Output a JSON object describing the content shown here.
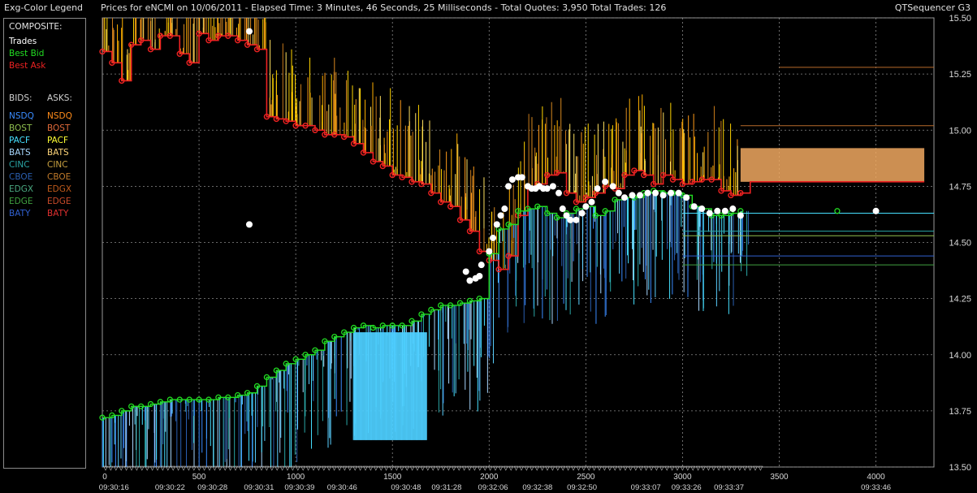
{
  "header": {
    "legend_title": "Exg-Color Legend",
    "chart_title": "Prices for  eNCMI  on  10/06/2011  -  Elapsed Time: 3 Minutes, 46 Seconds, 25 Milliseconds  -  Total Quotes: 3,950  Total Trades: 126",
    "app_name": "QTSequencer G3"
  },
  "legend": {
    "composite_label": "COMPOSITE:",
    "composite": [
      {
        "label": "Trades",
        "color": "#ffffff"
      },
      {
        "label": "Best Bid",
        "color": "#22dd22"
      },
      {
        "label": "Best Ask",
        "color": "#ee2222"
      }
    ],
    "bids_label": "BIDS:",
    "asks_label": "ASKS:",
    "exchanges": [
      {
        "bid": "NSDQ",
        "ask": "NSDQ",
        "bid_color": "#3a8cff",
        "ask_color": "#ff8c1a"
      },
      {
        "bid": "BOST",
        "ask": "BOST",
        "bid_color": "#8fbf4f",
        "ask_color": "#e06a3a"
      },
      {
        "bid": "PACF",
        "ask": "PACF",
        "bid_color": "#46e0ff",
        "ask_color": "#ffff33"
      },
      {
        "bid": "BATS",
        "ask": "BATS",
        "bid_color": "#a8d8ff",
        "ask_color": "#ffd67a"
      },
      {
        "bid": "CINC",
        "ask": "CINC",
        "bid_color": "#2aa6a6",
        "ask_color": "#c8a040"
      },
      {
        "bid": "CBOE",
        "ask": "CBOE",
        "bid_color": "#2a5fb0",
        "ask_color": "#c07a2a"
      },
      {
        "bid": "EDGX",
        "ask": "EDGX",
        "bid_color": "#4aa880",
        "ask_color": "#c05a1a"
      },
      {
        "bid": "EDGE",
        "ask": "EDGE",
        "bid_color": "#40a040",
        "ask_color": "#c84a2a"
      },
      {
        "bid": "BATY",
        "ask": "BATY",
        "bid_color": "#3060d0",
        "ask_color": "#e03030"
      }
    ]
  },
  "chart_data": {
    "type": "line",
    "ylim": [
      13.5,
      15.5
    ],
    "xlim": [
      0,
      4300
    ],
    "y_ticks": [
      "15.50",
      "15.25",
      "15.00",
      "14.75",
      "14.50",
      "14.25",
      "14.00",
      "13.75",
      "13.50"
    ],
    "x_ticks": [
      0,
      500,
      1000,
      1500,
      2000,
      2500,
      3000,
      3500,
      4000
    ],
    "time_labels": [
      {
        "x": 60,
        "label": "09:30:16"
      },
      {
        "x": 350,
        "label": "09:30:22"
      },
      {
        "x": 570,
        "label": "09:30:28"
      },
      {
        "x": 810,
        "label": "09:30:31"
      },
      {
        "x": 1020,
        "label": "09:30:39"
      },
      {
        "x": 1240,
        "label": "09:30:46"
      },
      {
        "x": 1570,
        "label": "09:30:48"
      },
      {
        "x": 1780,
        "label": "09:31:28"
      },
      {
        "x": 2020,
        "label": "09:32:06"
      },
      {
        "x": 2250,
        "label": "09:32:38"
      },
      {
        "x": 2480,
        "label": "09:32:50"
      },
      {
        "x": 2810,
        "label": "09:33:07"
      },
      {
        "x": 3020,
        "label": "09:33:26"
      },
      {
        "x": 3240,
        "label": "09:33:37"
      },
      {
        "x": 4000,
        "label": "09:33:46"
      }
    ],
    "grid": true,
    "series": [
      {
        "name": "Best Ask",
        "color": "#ee2222",
        "x": [
          0,
          50,
          100,
          150,
          200,
          250,
          300,
          350,
          400,
          450,
          500,
          550,
          600,
          650,
          700,
          750,
          800,
          850,
          900,
          950,
          1000,
          1050,
          1100,
          1150,
          1200,
          1250,
          1300,
          1350,
          1400,
          1450,
          1500,
          1550,
          1600,
          1650,
          1700,
          1750,
          1800,
          1850,
          1900,
          1950,
          2000,
          2050,
          2100,
          2150,
          2200,
          2250,
          2300,
          2350,
          2400,
          2450,
          2500,
          2550,
          2600,
          2650,
          2700,
          2750,
          2800,
          2850,
          2900,
          2950,
          3000,
          3050,
          3100,
          3150,
          3200,
          3250,
          3300,
          3350,
          3400,
          3450,
          3500,
          3550,
          3600,
          3650,
          3700,
          3750,
          3800,
          3850,
          3900,
          3950,
          4000,
          4050,
          4100,
          4150,
          4200,
          4250
        ],
        "values": [
          15.35,
          15.3,
          15.22,
          15.38,
          15.4,
          15.36,
          15.42,
          15.42,
          15.34,
          15.3,
          15.43,
          15.4,
          15.42,
          15.42,
          15.4,
          15.38,
          15.36,
          15.06,
          15.05,
          15.04,
          15.02,
          15.02,
          15.0,
          14.98,
          14.98,
          14.97,
          14.94,
          14.9,
          14.86,
          14.84,
          14.8,
          14.79,
          14.77,
          14.76,
          14.72,
          14.68,
          14.66,
          14.6,
          14.55,
          14.46,
          14.42,
          14.38,
          14.44,
          14.62,
          14.75,
          14.76,
          14.8,
          14.81,
          14.72,
          14.68,
          14.7,
          14.72,
          14.75,
          14.74,
          14.8,
          14.82,
          14.8,
          14.76,
          14.8,
          14.78,
          14.76,
          14.77,
          14.78,
          14.78,
          14.73,
          14.71,
          14.72,
          14.77,
          14.77,
          14.77,
          14.77,
          14.77,
          14.77,
          14.77,
          14.77,
          14.77,
          14.77,
          14.77,
          14.77,
          14.77,
          14.77,
          14.77,
          14.77,
          14.77,
          14.77,
          14.77
        ]
      },
      {
        "name": "Best Bid",
        "color": "#22dd22",
        "x": [
          0,
          50,
          100,
          150,
          200,
          250,
          300,
          350,
          400,
          450,
          500,
          550,
          600,
          650,
          700,
          750,
          800,
          850,
          900,
          950,
          1000,
          1050,
          1100,
          1150,
          1200,
          1250,
          1300,
          1350,
          1400,
          1450,
          1500,
          1550,
          1600,
          1650,
          1700,
          1750,
          1800,
          1850,
          1900,
          1950,
          2000,
          2050,
          2100,
          2150,
          2200,
          2250,
          2300,
          2350,
          2400,
          2450,
          2500,
          2550,
          2600,
          2650,
          2700,
          2750,
          2800,
          2850,
          2900,
          2950,
          3000,
          3050,
          3100,
          3150,
          3200,
          3250,
          3300
        ],
        "values": [
          13.72,
          13.73,
          13.75,
          13.77,
          13.77,
          13.78,
          13.79,
          13.8,
          13.8,
          13.8,
          13.8,
          13.8,
          13.81,
          13.81,
          13.82,
          13.83,
          13.86,
          13.9,
          13.93,
          13.96,
          13.98,
          14.0,
          14.02,
          14.06,
          14.08,
          14.1,
          14.12,
          14.13,
          14.12,
          14.13,
          14.13,
          14.13,
          14.15,
          14.18,
          14.2,
          14.22,
          14.22,
          14.23,
          14.24,
          14.25,
          14.45,
          14.56,
          14.58,
          14.64,
          14.65,
          14.66,
          14.63,
          14.61,
          14.63,
          14.65,
          14.66,
          14.62,
          14.64,
          14.69,
          14.7,
          14.7,
          14.72,
          14.73,
          14.72,
          14.72,
          14.71,
          14.66,
          14.65,
          14.62,
          14.62,
          14.63,
          14.64
        ]
      },
      {
        "name": "Trades",
        "color": "#ffffff",
        "x": [
          760,
          760,
          1880,
          1900,
          1930,
          1950,
          1960,
          2000,
          2020,
          2040,
          2060,
          2080,
          2100,
          2120,
          2150,
          2170,
          2200,
          2220,
          2240,
          2260,
          2280,
          2300,
          2330,
          2360,
          2380,
          2400,
          2420,
          2450,
          2480,
          2500,
          2530,
          2560,
          2600,
          2640,
          2670,
          2700,
          2740,
          2780,
          2820,
          2860,
          2900,
          2940,
          2980,
          3020,
          3060,
          3100,
          3140,
          3180,
          3220,
          3260,
          3300,
          4000
        ],
        "values": [
          15.44,
          14.58,
          14.37,
          14.33,
          14.34,
          14.35,
          14.4,
          14.46,
          14.52,
          14.58,
          14.62,
          14.65,
          14.75,
          14.78,
          14.79,
          14.79,
          14.75,
          14.74,
          14.74,
          14.75,
          14.74,
          14.74,
          14.75,
          14.72,
          14.65,
          14.62,
          14.6,
          14.6,
          14.63,
          14.66,
          14.68,
          14.74,
          14.77,
          14.75,
          14.72,
          14.7,
          14.71,
          14.71,
          14.72,
          14.72,
          14.71,
          14.72,
          14.72,
          14.7,
          14.66,
          14.65,
          14.63,
          14.64,
          14.64,
          14.65,
          14.62,
          14.64
        ]
      }
    ]
  }
}
